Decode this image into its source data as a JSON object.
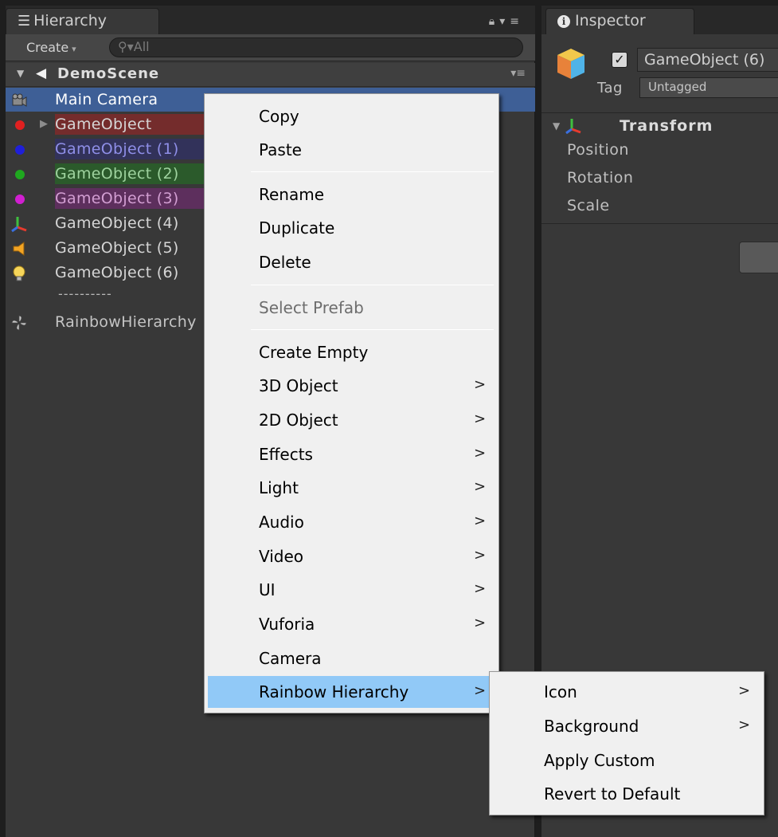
{
  "hierarchy": {
    "tab_label": "Hierarchy",
    "create_label": "Create",
    "search_placeholder": "All",
    "scene_name": "DemoScene",
    "items": [
      {
        "label": "Main Camera",
        "icon": "camera-icon"
      },
      {
        "label": "GameObject",
        "icon": "red-dot-icon",
        "color": "#e02020",
        "bg": "#742c2c"
      },
      {
        "label": "GameObject (1)",
        "icon": "blue-dot-icon",
        "color": "#1f1fd9",
        "bg": "#32325a"
      },
      {
        "label": "GameObject (2)",
        "icon": "green-dot-icon",
        "color": "#1fa81f",
        "bg": "#2b5a2b"
      },
      {
        "label": "GameObject (3)",
        "icon": "magenta-dot-icon",
        "color": "#d11fd1",
        "bg": "#5d2f5d"
      },
      {
        "label": "GameObject (4)",
        "icon": "transform-axes-icon"
      },
      {
        "label": "GameObject (5)",
        "icon": "audio-source-icon"
      },
      {
        "label": "GameObject (6)",
        "icon": "light-bulb-icon"
      },
      {
        "label": "----------",
        "icon": ""
      },
      {
        "label": "RainbowHierarchy",
        "icon": "pinwheel-icon"
      }
    ]
  },
  "inspector": {
    "tab_label": "Inspector",
    "object_name": "GameObject (6)",
    "tag_label": "Tag",
    "tag_value": "Untagged",
    "component_name": "Transform",
    "properties": [
      "Position",
      "Rotation",
      "Scale"
    ]
  },
  "context_menu": {
    "items": [
      {
        "label": "Copy"
      },
      {
        "label": "Paste"
      },
      {
        "label": "Rename"
      },
      {
        "label": "Duplicate"
      },
      {
        "label": "Delete"
      },
      {
        "label": "Select Prefab",
        "disabled": true
      },
      {
        "label": "Create Empty"
      },
      {
        "label": "3D Object",
        "submenu": true
      },
      {
        "label": "2D Object",
        "submenu": true
      },
      {
        "label": "Effects",
        "submenu": true
      },
      {
        "label": "Light",
        "submenu": true
      },
      {
        "label": "Audio",
        "submenu": true
      },
      {
        "label": "Video",
        "submenu": true
      },
      {
        "label": "UI",
        "submenu": true
      },
      {
        "label": "Vuforia",
        "submenu": true
      },
      {
        "label": "Camera"
      },
      {
        "label": "Rainbow Hierarchy",
        "submenu": true,
        "highlighted": true
      }
    ],
    "submenu_arrow": ">"
  },
  "rainbow_submenu": {
    "items": [
      {
        "label": "Icon",
        "submenu": true
      },
      {
        "label": "Background",
        "submenu": true
      },
      {
        "label": "Apply Custom"
      },
      {
        "label": "Revert to Default"
      }
    ]
  },
  "colors": {
    "selection": "#3e5f96",
    "menu_highlight": "#91c9f7",
    "panel_bg": "#383838"
  }
}
